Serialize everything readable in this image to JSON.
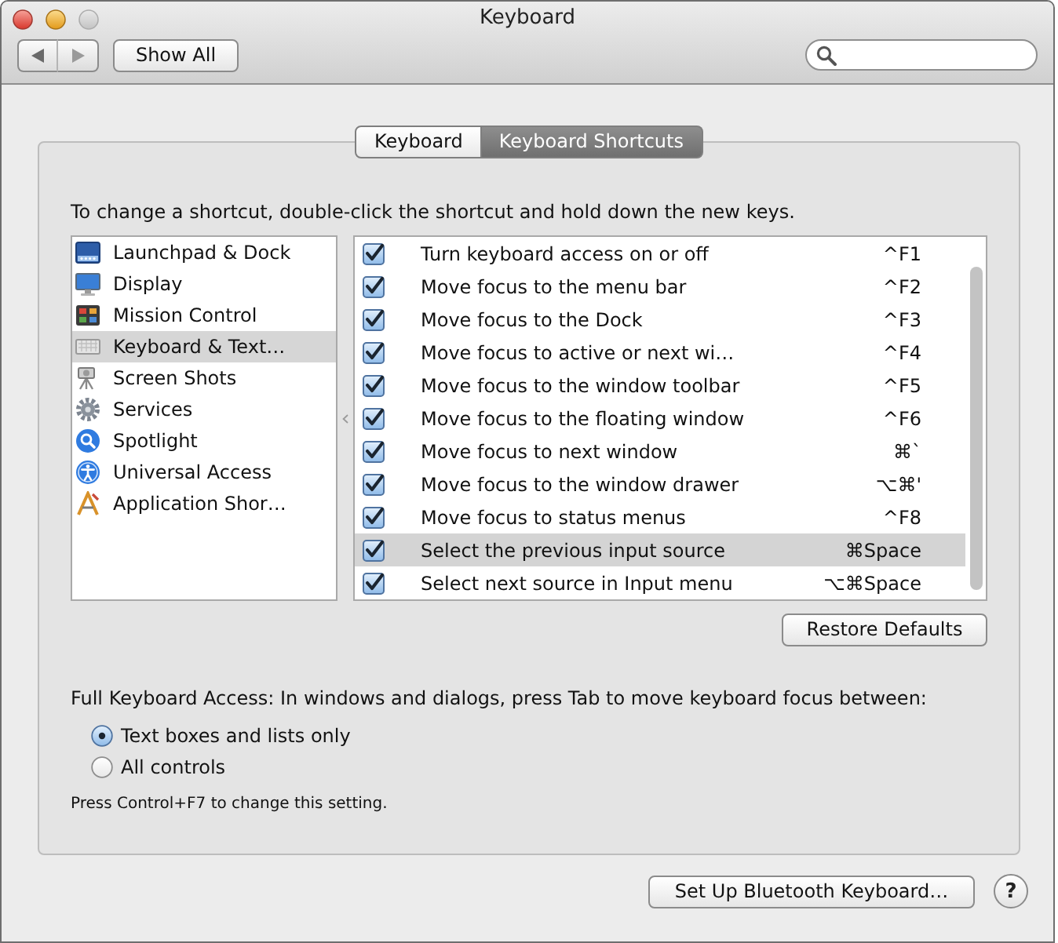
{
  "window": {
    "title": "Keyboard",
    "zoom_enabled": false
  },
  "toolbar": {
    "show_all": "Show All"
  },
  "tabs": [
    {
      "label": "Keyboard",
      "selected": false
    },
    {
      "label": "Keyboard Shortcuts",
      "selected": true
    }
  ],
  "instruction": "To change a shortcut, double-click the shortcut and hold down the new keys.",
  "categories": [
    {
      "label": "Launchpad & Dock",
      "selected": false
    },
    {
      "label": "Display",
      "selected": false
    },
    {
      "label": "Mission Control",
      "selected": false
    },
    {
      "label": "Keyboard & Text…",
      "selected": true
    },
    {
      "label": "Screen Shots",
      "selected": false
    },
    {
      "label": "Services",
      "selected": false
    },
    {
      "label": "Spotlight",
      "selected": false
    },
    {
      "label": "Universal Access",
      "selected": false
    },
    {
      "label": "Application Shor…",
      "selected": false
    }
  ],
  "shortcuts": [
    {
      "label": "Turn keyboard access on or off",
      "keys": "^F1",
      "checked": true,
      "selected": false
    },
    {
      "label": "Move focus to the menu bar",
      "keys": "^F2",
      "checked": true,
      "selected": false
    },
    {
      "label": "Move focus to the Dock",
      "keys": "^F3",
      "checked": true,
      "selected": false
    },
    {
      "label": "Move focus to active or next wi…",
      "keys": "^F4",
      "checked": true,
      "selected": false
    },
    {
      "label": "Move focus to the window toolbar",
      "keys": "^F5",
      "checked": true,
      "selected": false
    },
    {
      "label": "Move focus to the floating window",
      "keys": "^F6",
      "checked": true,
      "selected": false
    },
    {
      "label": "Move focus to next window",
      "keys": "⌘`",
      "checked": true,
      "selected": false
    },
    {
      "label": "Move focus to the window drawer",
      "keys": "⌥⌘'",
      "checked": true,
      "selected": false
    },
    {
      "label": "Move focus to status menus",
      "keys": "^F8",
      "checked": true,
      "selected": false
    },
    {
      "label": "Select the previous input source",
      "keys": "⌘Space",
      "checked": true,
      "selected": true
    },
    {
      "label": "Select next source in Input menu",
      "keys": "⌥⌘Space",
      "checked": true,
      "selected": false
    }
  ],
  "restore_button": "Restore Defaults",
  "full_keyboard_access": {
    "label": "Full Keyboard Access: In windows and dialogs, press Tab to move keyboard focus between:",
    "options": [
      {
        "label": "Text boxes and lists only",
        "selected": true
      },
      {
        "label": "All controls",
        "selected": false
      }
    ],
    "note": "Press Control+F7 to change this setting."
  },
  "footer": {
    "bluetooth_button": "Set Up Bluetooth Keyboard…",
    "help": "?"
  }
}
